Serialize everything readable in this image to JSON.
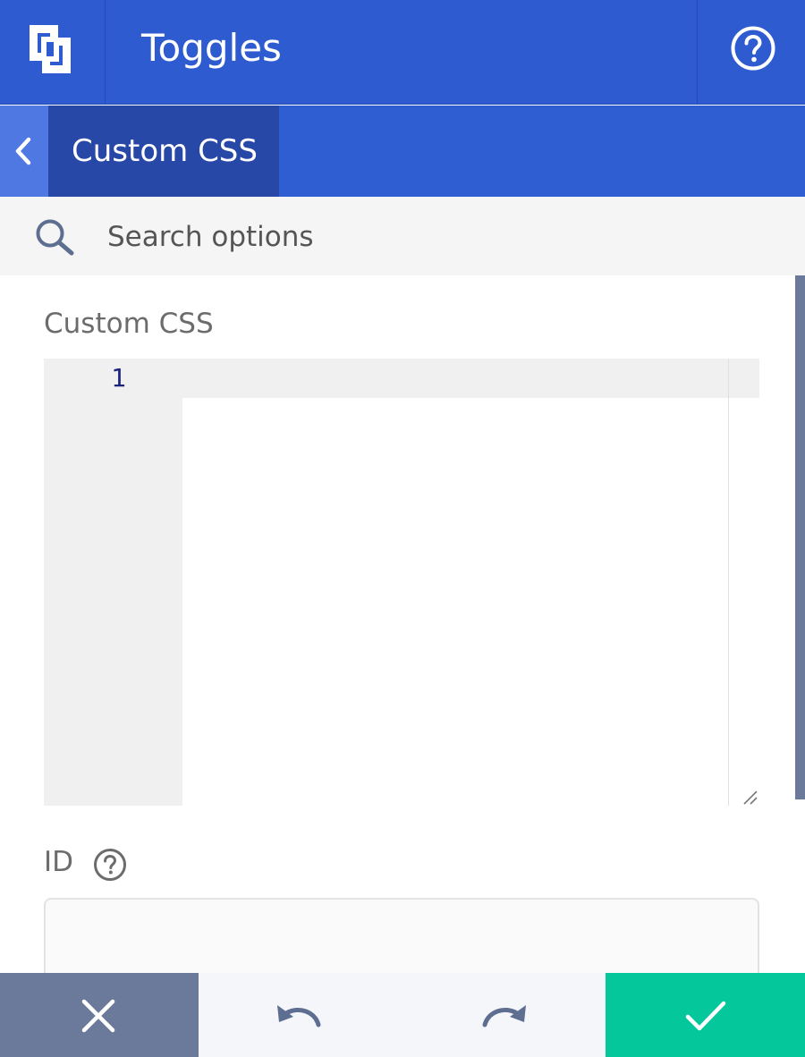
{
  "header": {
    "title": "Toggles",
    "logo_icon": "brand-logo-icon",
    "help_icon": "help-circle-icon"
  },
  "breadcrumb": {
    "back_icon": "chevron-left-icon",
    "current": "Custom CSS"
  },
  "search": {
    "placeholder": "Search options",
    "icon": "search-icon"
  },
  "fields": {
    "custom_css": {
      "label": "Custom CSS",
      "line_numbers": [
        "1"
      ],
      "value": ""
    },
    "id": {
      "label": "ID",
      "help_icon": "help-circle-icon",
      "value": ""
    }
  },
  "footer": {
    "cancel_icon": "close-icon",
    "undo_icon": "undo-icon",
    "redo_icon": "redo-icon",
    "save_icon": "check-icon"
  },
  "colors": {
    "header_bg": "#2e5bd0",
    "breadcrumb_active_bg": "#2848a8",
    "cancel_bg": "#6b7a9b",
    "save_bg": "#04c79c"
  }
}
